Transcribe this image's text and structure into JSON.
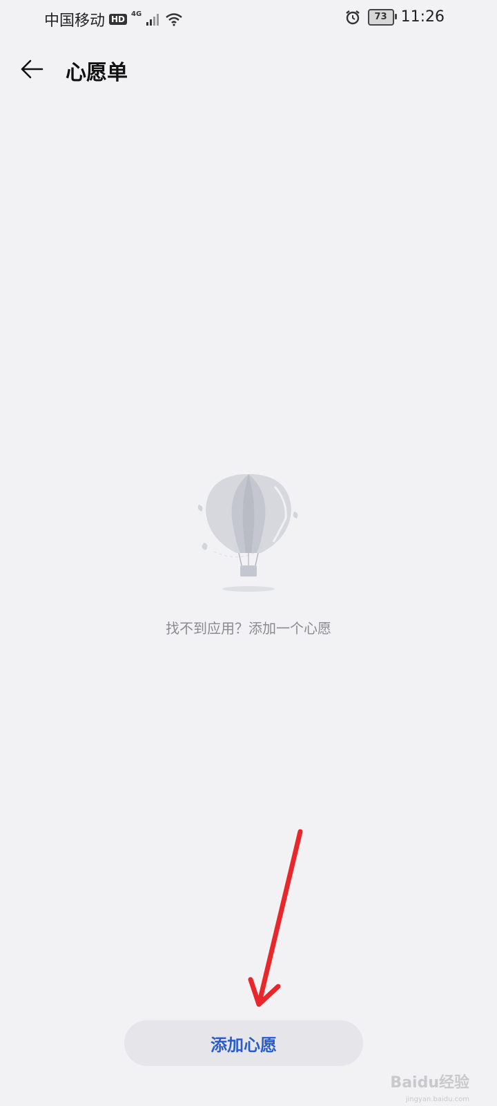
{
  "status_bar": {
    "carrier": "中国移动",
    "hd_badge": "HD",
    "network": "4G",
    "battery": "73",
    "time": "11:26",
    "icons": [
      "signal-icon",
      "wifi-icon",
      "alarm-icon",
      "battery-icon"
    ]
  },
  "app_bar": {
    "title": "心愿单",
    "back_icon": "arrow-left-icon"
  },
  "empty_state": {
    "illustration": "hot-air-balloon",
    "message": "找不到应用？添加一个心愿"
  },
  "actions": {
    "add_wish_label": "添加心愿"
  },
  "watermark": {
    "text": "Baidu经验",
    "sub": "jingyan.baidu.com"
  },
  "colors": {
    "background": "#f2f2f5",
    "button_text": "#2a5cc8",
    "annotation_arrow": "#e8272b"
  }
}
